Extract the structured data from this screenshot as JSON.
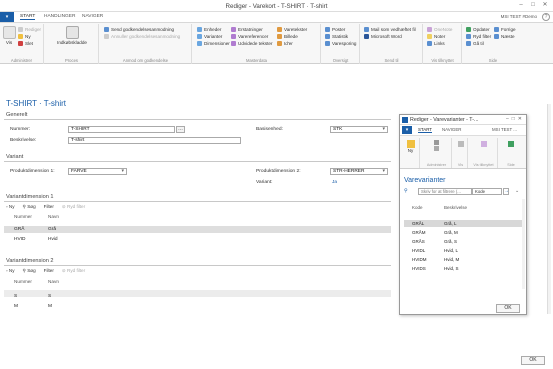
{
  "window": {
    "title": "Rediger - Varekort - T-SHIRT · T-shirt"
  },
  "tabs": {
    "file": "▾",
    "items": [
      "START",
      "HANDLINGER",
      "NAVIGER"
    ]
  },
  "user": "MSI TEST #Demo",
  "ribbon": {
    "vis": "Vis",
    "admin": {
      "edit": "Rediger",
      "new": "Ny",
      "delete": "Slet",
      "label": "Administrer"
    },
    "process": {
      "doc": "Indkøbskladde",
      "label": "Proces"
    },
    "approval": {
      "send": "Send godkendelsesanmodning",
      "cancel": "Annuller godkendelsesanmodning",
      "label": "Anmod om godkendelse"
    },
    "master": {
      "units": "Enheder",
      "variants": "Varianter",
      "dimensions": "Dimensioner",
      "substitutes": "Erstatninger",
      "refs": "Varereferencer",
      "ext_texts": "Udvidede tekster",
      "texts": "Varetekster",
      "picture": "Billede",
      "id": "Id'er",
      "label": "Masterdata"
    },
    "overview": {
      "entries": "Poster",
      "stats": "Statistik",
      "tracking": "Varesporing",
      "label": "Oversigt"
    },
    "send": {
      "mail": "Mail som vedhæftet fil",
      "word": "Microsoft Word",
      "label": "Send til"
    },
    "show": {
      "onenote": "OneNote",
      "notes": "Noter",
      "links": "Links",
      "label": "Vis tilknyttet"
    },
    "page": {
      "refresh": "Opdater",
      "clear": "Ryd filter",
      "goto": "Gå til",
      "prev": "Forrige",
      "next": "Næste",
      "label": "Side"
    }
  },
  "page": {
    "title": "T-SHIRT · T-shirt"
  },
  "general": {
    "header": "Generelt",
    "number_label": "Nummer:",
    "number_value": "T-SHIRT",
    "desc_label": "Beskrivelse:",
    "desc_value": "T-shirt",
    "base_label": "Basisenhed:",
    "base_value": "STK"
  },
  "variant": {
    "header": "Variant",
    "dim1_label": "Produktdimension 1:",
    "dim1_value": "FARVE",
    "dim2_label": "Produktdimension 2:",
    "dim2_value": "STR-HERRER",
    "variant_label": "Variant:",
    "variant_value": "Ja"
  },
  "vdim1": {
    "header": "Variantdimension 1",
    "toolbar": {
      "new": "Ny",
      "search": "Søg",
      "filter": "Filter",
      "clear": "Ryd filter"
    },
    "cols": [
      "Nummer",
      "Navn"
    ],
    "rows": [
      {
        "num": "GRÅ",
        "name": "Grå"
      },
      {
        "num": "HVID",
        "name": "Hvid"
      }
    ]
  },
  "vdim2": {
    "header": "Variantdimension 2",
    "toolbar": {
      "new": "Ny",
      "search": "Søg",
      "filter": "Filter",
      "clear": "Ryd filter"
    },
    "cols": [
      "Nummer",
      "Navn"
    ],
    "rows": [
      {
        "num": "S",
        "name": "S"
      },
      {
        "num": "M",
        "name": "M"
      }
    ]
  },
  "ok": "OK",
  "dialog": {
    "title": "Rediger - Varevarianter - T-...",
    "tabs": [
      "START",
      "NAVIGER"
    ],
    "user": "MSI TEST ...",
    "ribbon": {
      "new": "Ny",
      "admin": "Administrer",
      "vis": "Vis",
      "show": "Vis tilknyttet",
      "page": "Side"
    },
    "heading": "Varevarianter",
    "search_placeholder": "Skriv for at filtrere (...",
    "search_field": "Kode",
    "cols": [
      "Kode",
      "Beskrivelse"
    ],
    "rows": [
      {
        "code": "GRÅL",
        "desc": "Grå, L"
      },
      {
        "code": "GRÅM",
        "desc": "Grå, M"
      },
      {
        "code": "GRÅS",
        "desc": "Grå, S"
      },
      {
        "code": "HVIDL",
        "desc": "Hvid, L"
      },
      {
        "code": "HVIDM",
        "desc": "Hvid, M"
      },
      {
        "code": "HVIDS",
        "desc": "Hvid, S"
      }
    ],
    "ok": "OK"
  },
  "colors": {
    "accent": "#1a5ea8"
  }
}
